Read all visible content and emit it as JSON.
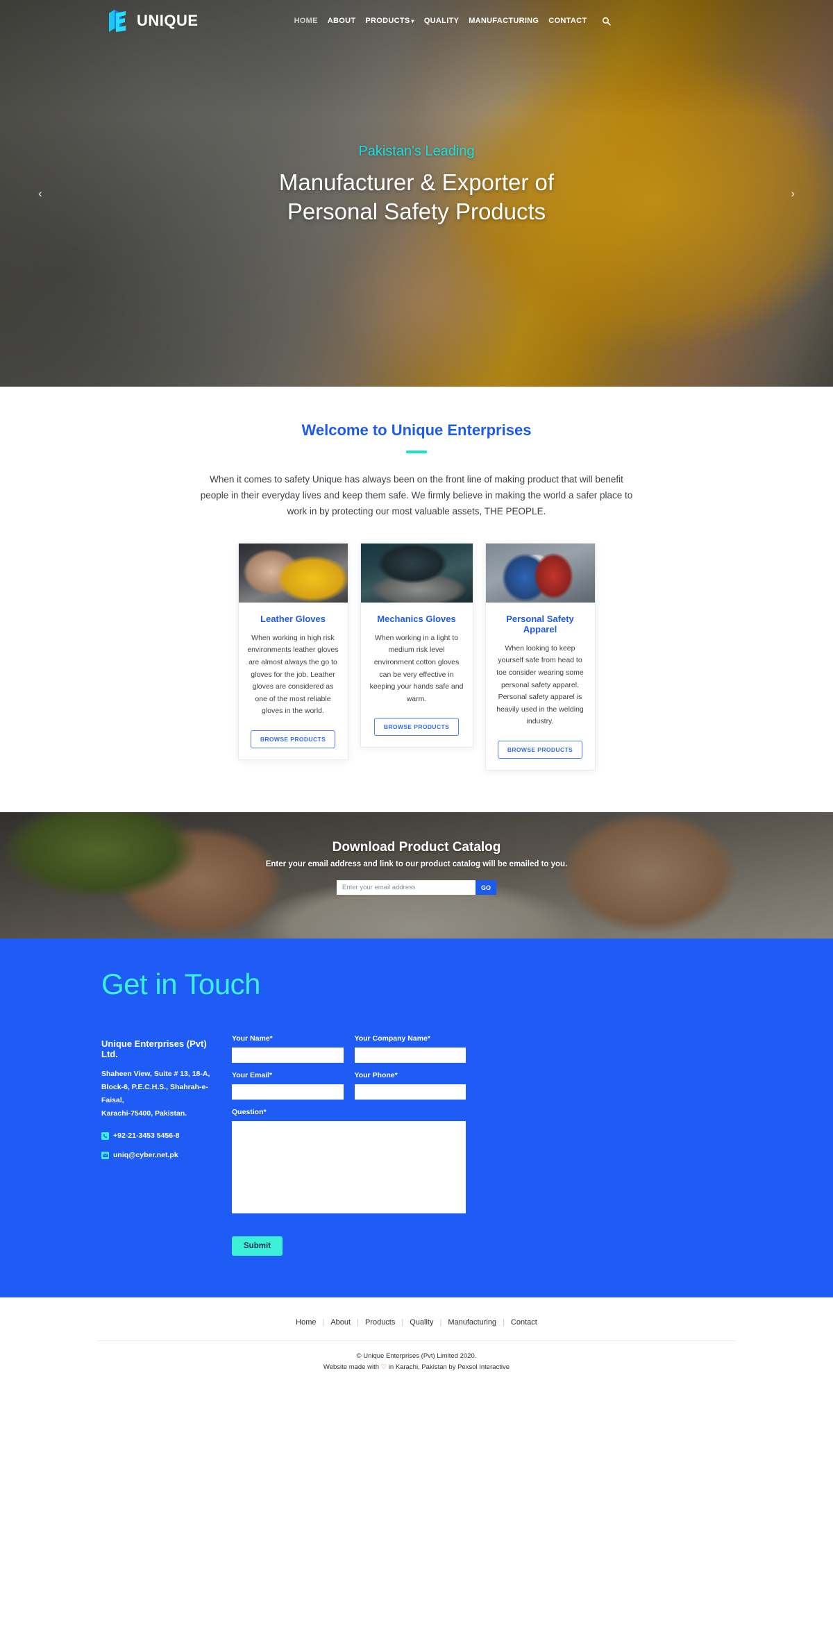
{
  "header": {
    "brand": "UNIQUE",
    "brand_icon": "cube-logo-icon",
    "nav": [
      {
        "label": "HOME",
        "state": "muted"
      },
      {
        "label": "ABOUT",
        "state": "normal"
      },
      {
        "label": "PRODUCTS",
        "state": "normal",
        "caret": "▾"
      },
      {
        "label": "QUALITY",
        "state": "normal"
      },
      {
        "label": "MANUFACTURING",
        "state": "normal"
      },
      {
        "label": "CONTACT",
        "state": "normal"
      }
    ],
    "search_icon": "search-icon"
  },
  "hero": {
    "kicker": "Pakistan's Leading",
    "title_line1": "Manufacturer & Exporter of",
    "title_line2": "Personal Safety Products",
    "prev_arrow": "‹",
    "next_arrow": "›"
  },
  "welcome": {
    "title": "Welcome to Unique Enterprises",
    "body": "When it comes to safety Unique has always been on the front line of making product that will benefit people in their everyday lives and keep them safe. We firmly believe in making the world a safer place to work in by protecting our most valuable assets, THE PEOPLE."
  },
  "cards": [
    {
      "title": "Leather Gloves",
      "text": "When working in high risk environments leather gloves are almost always the go to gloves for the job. Leather gloves are considered as one of the most reliable gloves in the world.",
      "button": "BROWSE PRODUCTS",
      "photo": "leather-gloves-photo"
    },
    {
      "title": "Mechanics Gloves",
      "text": "When working in a light to medium risk level environment cotton gloves can be very effective in keeping your hands safe and warm.",
      "button": "BROWSE PRODUCTS",
      "photo": "mechanics-gloves-photo"
    },
    {
      "title": "Personal Safety Apparel",
      "text": "When looking to keep yourself safe from head to toe consider wearing some personal safety apparel. Personal safety apparel is heavily used in the welding industry.",
      "button": "BROWSE PRODUCTS",
      "photo": "safety-apparel-photo"
    }
  ],
  "catalog": {
    "title": "Download Product Catalog",
    "subtitle": "Enter your email address and link to our product catalog will be emailed to you.",
    "placeholder": "Enter your email address",
    "value": "",
    "go_label": "GO"
  },
  "contact": {
    "heading": "Get in Touch",
    "company": "Unique Enterprises (Pvt) Ltd.",
    "address_line1": "Shaheen View, Suite # 13, 18-A,",
    "address_line2": "Block-6, P.E.C.H.S., Shahrah-e-Faisal,",
    "address_line3": "Karachi-75400, Pakistan.",
    "phone": "+92-21-3453 5456-8",
    "phone_icon": "phone-icon",
    "email": "uniq@cyber.net.pk",
    "email_icon": "envelope-icon",
    "form": {
      "name_label": "Your Name*",
      "name_value": "",
      "company_label": "Your Company Name*",
      "company_value": "",
      "email_label": "Your Email*",
      "email_value": "",
      "phone_label": "Your Phone*",
      "phone_value": "",
      "question_label": "Question*",
      "question_value": "",
      "submit_label": "Submit"
    }
  },
  "footer": {
    "links": [
      "Home",
      "About",
      "Products",
      "Quality",
      "Manufacturing",
      "Contact"
    ],
    "separator": "|",
    "copyright": "© Unique Enterprises (Pvt) Limited 2020.",
    "credit_prefix": "Website made with ",
    "credit_heart": "♡",
    "credit_suffix": " in Karachi, Pakistan by Pexsol Interactive"
  },
  "colors": {
    "brand_blue": "#1d5bef",
    "accent_cyan": "#3cf0d8",
    "contact_bg": "#1f5cf5"
  }
}
